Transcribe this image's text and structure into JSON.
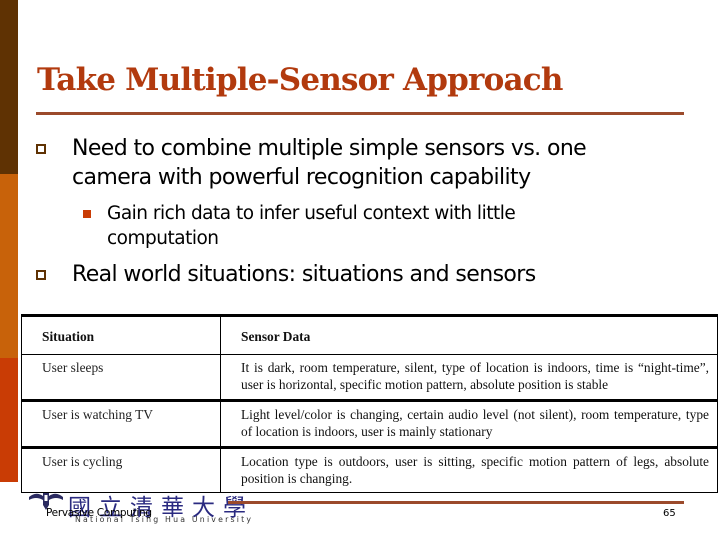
{
  "slide": {
    "title": "Take Multiple-Sensor Approach",
    "bullets": [
      {
        "lines": [
          "Need to combine multiple simple sensors vs. one",
          "camera with powerful recognition capability"
        ],
        "sub_bullets": [
          {
            "lines": [
              "Gain rich data to infer useful context with little",
              "computation"
            ]
          }
        ]
      },
      {
        "lines": [
          "Real world situations: situations and sensors"
        ]
      }
    ],
    "table": {
      "headers": [
        "Situation",
        "Sensor Data"
      ],
      "rows": [
        [
          "User sleeps",
          "It is dark, room temperature, silent, type of location is indoors, time is “night-time”, user is horizontal, specific motion pattern, absolute position is stable"
        ],
        [
          "User is watching TV",
          "Light level/color is changing, certain audio level (not silent), room temperature, type of location is indoors, user is mainly stationary"
        ],
        [
          "User is cycling",
          "Location type is outdoors, user is sitting, specific motion pattern of legs, absolute position is changing."
        ]
      ]
    }
  },
  "footer": {
    "logo_cjk": "國立清華大學",
    "logo_en": "National Tsing Hua University",
    "course": "Pervasive Computing",
    "page_number": "65"
  },
  "colors": {
    "sidebar_top": "#5f3203",
    "sidebar_mid": "#c8620a",
    "sidebar_bottom": "#c93c05",
    "title": "#b23a0e",
    "rule": "#9b4a2b",
    "sub_bullet": "#c93c05"
  }
}
